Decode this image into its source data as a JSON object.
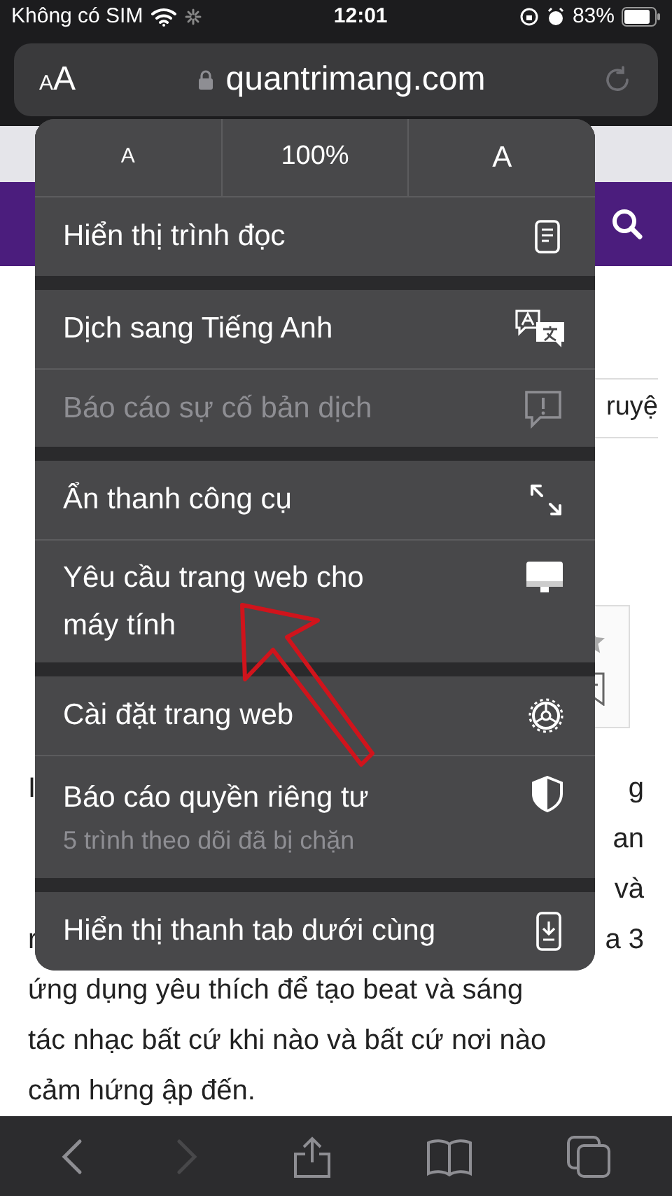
{
  "status_bar": {
    "carrier": "Không có SIM",
    "time": "12:01",
    "battery": "83%"
  },
  "address_bar": {
    "text_size_glyphs": [
      "A",
      "A"
    ],
    "url": "quantrimang.com"
  },
  "page": {
    "side_fragment": "ruyệ",
    "paragraph_lines": [
      {
        "left": "I",
        "right": "g"
      },
      {
        "right": "an"
      },
      {
        "right": "và"
      },
      {
        "left": "r",
        "right": "a 3"
      },
      {
        "text": "ứng dụng yêu thích để tạo beat và sáng"
      },
      {
        "text": "tác nhạc bất cứ khi nào và bất cứ nơi nào"
      },
      {
        "text": "cảm hứng ập đến."
      }
    ]
  },
  "menu": {
    "zoom": {
      "decrease": "A",
      "level": "100%",
      "increase": "A"
    },
    "groups": [
      [
        {
          "label": "Hiển thị trình đọc",
          "disabled": false
        }
      ],
      [
        {
          "label": "Dịch sang Tiếng Anh",
          "disabled": false
        },
        {
          "label": "Báo cáo sự cố bản dịch",
          "disabled": true
        }
      ],
      [
        {
          "label": "Ẩn thanh công cụ",
          "disabled": false
        },
        {
          "label": "Yêu cầu trang web cho máy tính",
          "disabled": false
        }
      ],
      [
        {
          "label": "Cài đặt trang web",
          "disabled": false
        },
        {
          "label": "Báo cáo quyền riêng tư",
          "sublabel": "5 trình theo dõi đã bị chặn",
          "disabled": false
        }
      ],
      [
        {
          "label": "Hiển thị thanh tab dưới cùng",
          "disabled": false
        }
      ]
    ]
  },
  "toolbar": {
    "back_enabled": true,
    "forward_enabled": false
  }
}
